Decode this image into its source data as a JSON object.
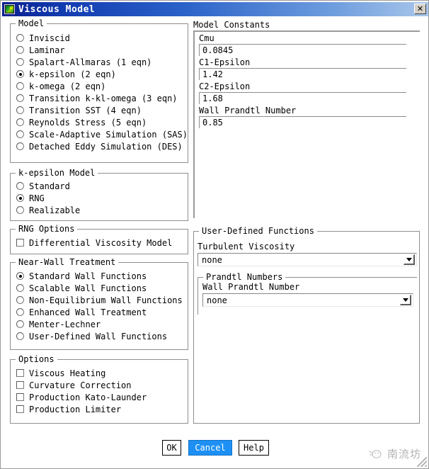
{
  "window": {
    "title": "Viscous Model",
    "icon": "fluent-app-icon",
    "close_label": "✕"
  },
  "model_group": {
    "legend": "Model",
    "selected": "k-epsilon (2 eqn)",
    "options": [
      {
        "label": "Inviscid",
        "selected": false
      },
      {
        "label": "Laminar",
        "selected": false
      },
      {
        "label": "Spalart-Allmaras (1 eqn)",
        "selected": false
      },
      {
        "label": "k-epsilon (2 eqn)",
        "selected": true
      },
      {
        "label": "k-omega (2 eqn)",
        "selected": false
      },
      {
        "label": "Transition k-kl-omega (3 eqn)",
        "selected": false
      },
      {
        "label": "Transition SST (4 eqn)",
        "selected": false
      },
      {
        "label": "Reynolds Stress (5 eqn)",
        "selected": false
      },
      {
        "label": "Scale-Adaptive Simulation (SAS)",
        "selected": false
      },
      {
        "label": "Detached Eddy Simulation (DES)",
        "selected": false
      }
    ]
  },
  "kepsilon_group": {
    "legend": "k-epsilon Model",
    "selected": "RNG",
    "options": [
      {
        "label": "Standard",
        "selected": false
      },
      {
        "label": "RNG",
        "selected": true
      },
      {
        "label": "Realizable",
        "selected": false
      }
    ]
  },
  "rng_options_group": {
    "legend": "RNG Options",
    "options": [
      {
        "label": "Differential Viscosity Model",
        "checked": false
      }
    ]
  },
  "near_wall_group": {
    "legend": "Near-Wall Treatment",
    "selected": "Standard Wall Functions",
    "options": [
      {
        "label": "Standard Wall Functions",
        "selected": true
      },
      {
        "label": "Scalable Wall Functions",
        "selected": false
      },
      {
        "label": "Non-Equilibrium Wall Functions",
        "selected": false
      },
      {
        "label": "Enhanced Wall Treatment",
        "selected": false
      },
      {
        "label": "Menter-Lechner",
        "selected": false
      },
      {
        "label": "User-Defined Wall Functions",
        "selected": false
      }
    ]
  },
  "options_group": {
    "legend": "Options",
    "options": [
      {
        "label": "Viscous Heating",
        "checked": false
      },
      {
        "label": "Curvature Correction",
        "checked": false
      },
      {
        "label": "Production Kato-Launder",
        "checked": false
      },
      {
        "label": "Production Limiter",
        "checked": false
      }
    ]
  },
  "model_constants": {
    "title": "Model Constants",
    "fields": [
      {
        "label": "Cmu",
        "value": "0.0845"
      },
      {
        "label": "C1-Epsilon",
        "value": "1.42"
      },
      {
        "label": "C2-Epsilon",
        "value": "1.68"
      },
      {
        "label": "Wall Prandtl Number",
        "value": "0.85"
      }
    ]
  },
  "udf_group": {
    "legend": "User-Defined Functions",
    "turbulent_viscosity_label": "Turbulent Viscosity",
    "turbulent_viscosity_value": "none",
    "prandtl_group_legend": "Prandtl Numbers",
    "wall_prandtl_label": "Wall Prandtl Number",
    "wall_prandtl_value": "none"
  },
  "footer": {
    "ok": "OK",
    "cancel": "Cancel",
    "help": "Help",
    "watermark_text": "南流坊"
  },
  "colors": {
    "title_bar_start": "#0a1f8f",
    "title_bar_end": "#a9c6ea",
    "primary_button": "#1e90f5",
    "dialog_bg": "#ffffff",
    "border": "#8e8e8e"
  }
}
